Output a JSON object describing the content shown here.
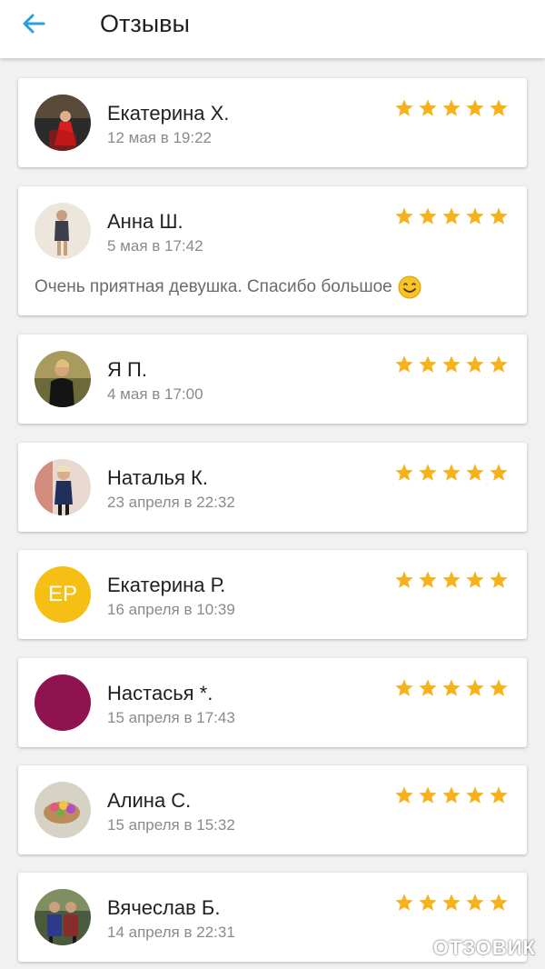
{
  "header": {
    "title": "Отзывы",
    "back_icon": "arrow-left-icon",
    "accent_color": "#29a0d8"
  },
  "rating_color": "#f5b21b",
  "reviews": [
    {
      "name": "Екатерина Х.",
      "date": "12 мая в 19:22",
      "rating": 5,
      "comment": ""
    },
    {
      "name": "Анна Ш.",
      "date": "5 мая в 17:42",
      "rating": 5,
      "comment": "Очень приятная девушка. Спасибо большое"
    },
    {
      "name": "Я П.",
      "date": "4 мая в 17:00",
      "rating": 5,
      "comment": ""
    },
    {
      "name": "Наталья К.",
      "date": "23 апреля в 22:32",
      "rating": 5,
      "comment": ""
    },
    {
      "name": "Екатерина Р.",
      "date": "16 апреля в 10:39",
      "rating": 5,
      "comment": "",
      "initials": "ЕР",
      "avatar_color": "#f5bf14"
    },
    {
      "name": "Настасья *.",
      "date": "15 апреля в 17:43",
      "rating": 5,
      "comment": "",
      "avatar_color": "#8e1350"
    },
    {
      "name": "Алина С.",
      "date": "15 апреля в 15:32",
      "rating": 5,
      "comment": ""
    },
    {
      "name": "Вячеслав Б.",
      "date": "14 апреля в 22:31",
      "rating": 5,
      "comment": ""
    }
  ],
  "watermark": {
    "text": "ОТЗОВИК"
  }
}
